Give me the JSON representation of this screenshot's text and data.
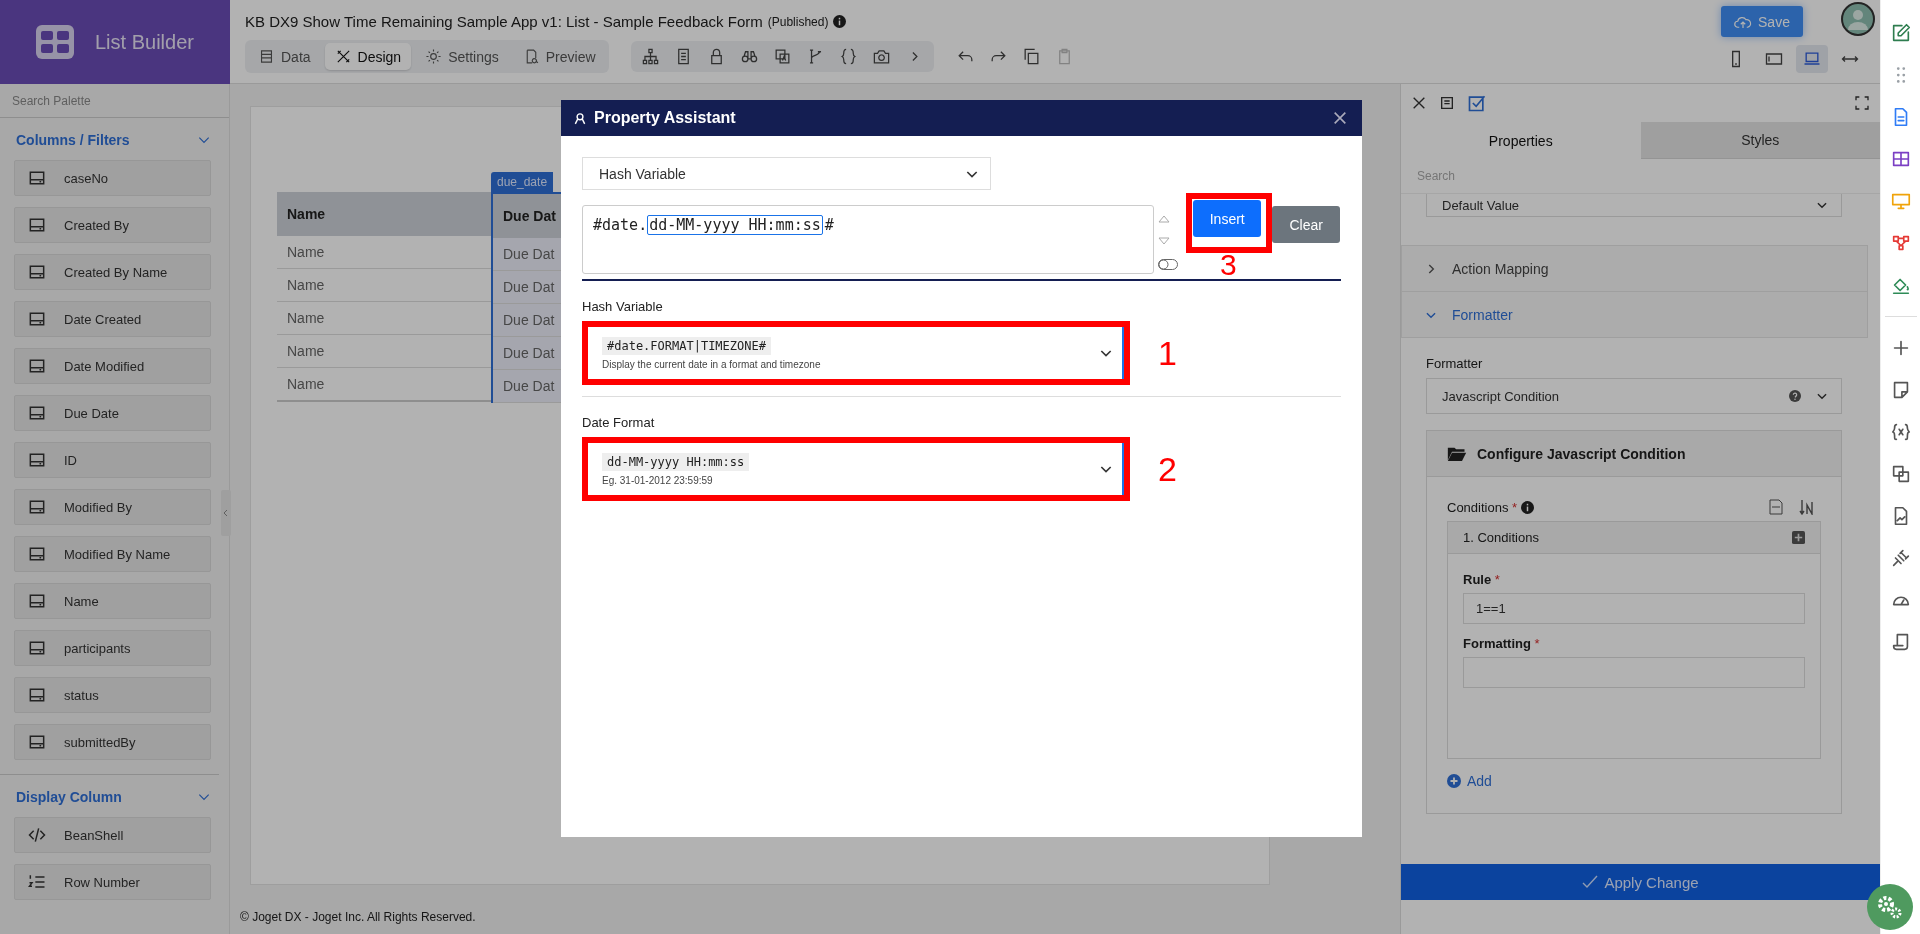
{
  "app": {
    "title": "List Builder"
  },
  "header": {
    "title": "KB DX9 Show Time Remaining Sample App v1: List - Sample Feedback Form",
    "status": "(Published)",
    "save": "Save"
  },
  "tabs": [
    {
      "label": "Data",
      "kind": "data",
      "selected": false
    },
    {
      "label": "Design",
      "kind": "design",
      "selected": true
    },
    {
      "label": "Settings",
      "kind": "settings",
      "selected": false
    },
    {
      "label": "Preview",
      "kind": "preview",
      "selected": false
    }
  ],
  "device_modes": [
    {
      "kind": "phone",
      "selected": false
    },
    {
      "kind": "tablet",
      "selected": false
    },
    {
      "kind": "laptop",
      "selected": true
    },
    {
      "kind": "full",
      "selected": false
    }
  ],
  "palette": {
    "search_placeholder": "Search Palette",
    "sections": [
      {
        "title": "Columns / Filters",
        "expanded": true,
        "items": [
          {
            "label": "caseNo",
            "kind": "column"
          },
          {
            "label": "Created By",
            "kind": "column"
          },
          {
            "label": "Created By Name",
            "kind": "column"
          },
          {
            "label": "Date Created",
            "kind": "column"
          },
          {
            "label": "Date Modified",
            "kind": "column"
          },
          {
            "label": "Due Date",
            "kind": "column"
          },
          {
            "label": "ID",
            "kind": "column"
          },
          {
            "label": "Modified By",
            "kind": "column"
          },
          {
            "label": "Modified By Name",
            "kind": "column"
          },
          {
            "label": "Name",
            "kind": "column"
          },
          {
            "label": "participants",
            "kind": "column"
          },
          {
            "label": "status",
            "kind": "column"
          },
          {
            "label": "submittedBy",
            "kind": "column"
          }
        ]
      },
      {
        "title": "Display Column",
        "expanded": true,
        "items": [
          {
            "label": "BeanShell",
            "kind": "code"
          },
          {
            "label": "Row Number",
            "kind": "numbered"
          }
        ]
      }
    ]
  },
  "canvas": {
    "column_tag": "due_date",
    "columns": [
      "Name",
      "Due Dat"
    ],
    "rows": [
      [
        "Name",
        "Due Dat"
      ],
      [
        "Name",
        "Due Dat"
      ],
      [
        "Name",
        "Due Dat"
      ],
      [
        "Name",
        "Due Dat"
      ],
      [
        "Name",
        "Due Dat"
      ]
    ],
    "footer": "© Joget DX - Joget Inc. All Rights Reserved."
  },
  "dialog": {
    "title": "Property Assistant",
    "type_select": "Hash Variable",
    "expression": {
      "prefix": "#date.",
      "highlight": "dd-MM-yyyy HH:mm:ss",
      "suffix": "#"
    },
    "insert": "Insert",
    "clear": "Clear",
    "insert_marker": "3",
    "fields": [
      {
        "label": "Hash Variable",
        "code": "#date.FORMAT|TIMEZONE#",
        "hint": "Display the current date in a format and timezone",
        "marker": "1"
      },
      {
        "label": "Date Format",
        "code": "dd-MM-yyyy HH:mm:ss",
        "hint": "Eg. 31-01-2012 23:59:59",
        "marker": "2"
      }
    ]
  },
  "properties": {
    "tabs": [
      {
        "label": "Properties",
        "selected": true
      },
      {
        "label": "Styles",
        "selected": false
      }
    ],
    "search_placeholder": "Search",
    "default_value": "Default Value",
    "sections": [
      {
        "title": "Action Mapping",
        "expanded": false
      },
      {
        "title": "Formatter",
        "expanded": true
      }
    ],
    "formatter_label": "Formatter",
    "formatter_value": "Javascript Condition",
    "config_title": "Configure Javascript Condition",
    "conditions_label": {
      "text": "Conditions",
      "mark": "*"
    },
    "condition_title": "1. Conditions",
    "rule_label": {
      "text": "Rule",
      "mark": "*"
    },
    "rule_value": "1==1",
    "formatting_label": {
      "text": "Formatting",
      "mark": "*"
    },
    "add": "Add",
    "apply": "Apply Change"
  }
}
